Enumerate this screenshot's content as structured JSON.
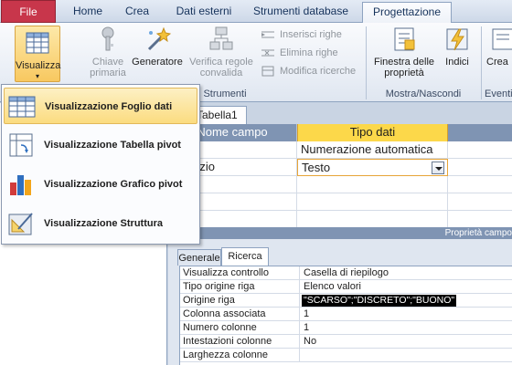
{
  "ribbon_tabs": [
    "File",
    "Home",
    "Crea",
    "Dati esterni",
    "Strumenti database",
    "Progettazione"
  ],
  "ribbon": {
    "view_button": "Visualizza",
    "primary_key": [
      "Chiave",
      "primaria"
    ],
    "builder": "Generatore",
    "verify_rules": [
      "Verifica regole",
      "convalida"
    ],
    "insert_rows": "Inserisci righe",
    "delete_rows": "Elimina righe",
    "modify_lookups": "Modifica ricerche",
    "tools_group": "Strumenti",
    "property_sheet": [
      "Finestra delle",
      "proprietà"
    ],
    "indexes": "Indici",
    "show_hide_group": "Mostra/Nascondi",
    "create_cut": "Crea",
    "events_cut": "Eventi"
  },
  "view_menu": [
    {
      "label": "Visualizzazione Foglio dati",
      "icon": "datasheet-view-icon",
      "active": true
    },
    {
      "label": "Visualizzazione Tabella pivot",
      "icon": "pivot-table-icon",
      "active": false
    },
    {
      "label": "Visualizzazione Grafico pivot",
      "icon": "pivot-chart-icon",
      "active": false
    },
    {
      "label": "Visualizzazione Struttura",
      "icon": "design-view-icon",
      "active": false
    }
  ],
  "document": {
    "tab_label": "Tabella1",
    "columns": [
      "Nome campo",
      "Tipo dati"
    ],
    "rows": [
      {
        "name": "",
        "type": "Numerazione automatica"
      },
      {
        "name": "Giudizio",
        "type": "Testo"
      }
    ]
  },
  "properties": {
    "header": "Proprietà campo",
    "tabs": [
      "Generale",
      "Ricerca"
    ],
    "rows": [
      {
        "key": "Visualizza controllo",
        "value": "Casella di riepilogo"
      },
      {
        "key": "Tipo origine riga",
        "value": "Elenco valori"
      },
      {
        "key": "Origine riga",
        "value": "\"SCARSO\";\"DISCRETO\";\"BUONO\""
      },
      {
        "key": "Colonna associata",
        "value": "1"
      },
      {
        "key": "Numero colonne",
        "value": "1"
      },
      {
        "key": "Intestazioni colonne",
        "value": "No"
      },
      {
        "key": "Larghezza colonne",
        "value": ""
      }
    ]
  },
  "colors": {
    "file_tab": "#c8364b",
    "selected_header": "#fcd84a",
    "header_blue": "#7f94b3",
    "menu_highlight": "#fbdc80"
  }
}
